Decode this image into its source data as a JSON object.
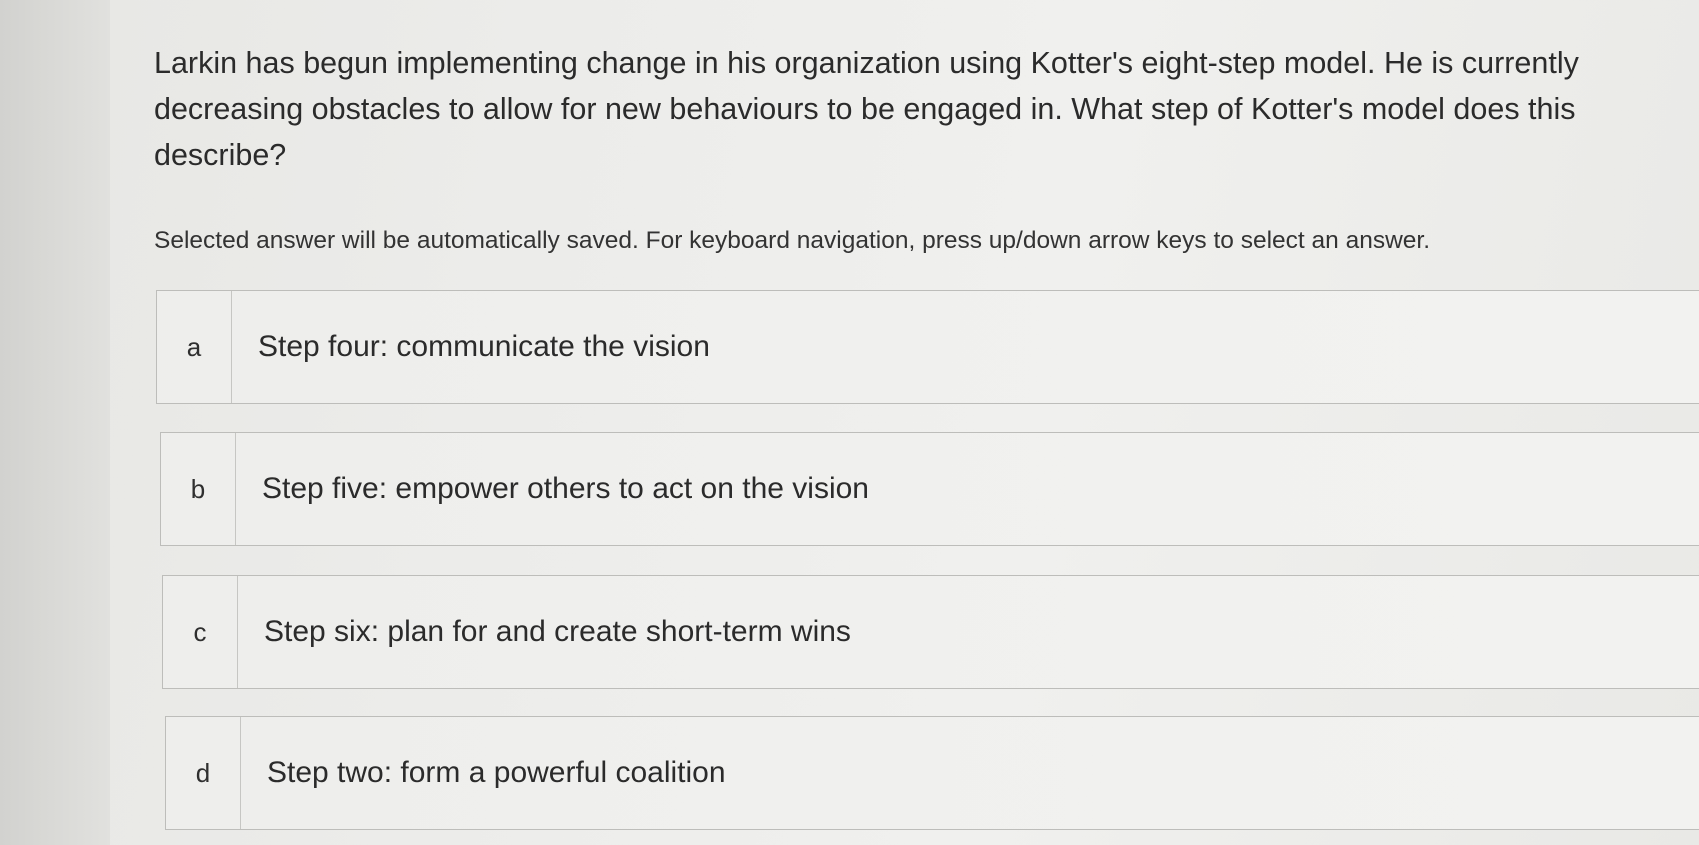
{
  "question": {
    "text": "Larkin has begun implementing change in his organization using Kotter's eight-step model. He is currently decreasing obstacles to allow for new behaviours to be engaged in. What step of Kotter's model does this describe?"
  },
  "instructions": "Selected answer will be automatically saved. For keyboard navigation, press up/down arrow keys to select an answer.",
  "options": [
    {
      "letter": "a",
      "text": "Step four: communicate the vision"
    },
    {
      "letter": "b",
      "text": "Step five: empower others to act on the vision"
    },
    {
      "letter": "c",
      "text": "Step six: plan for and create short-term wins"
    },
    {
      "letter": "d",
      "text": "Step two: form a powerful coalition"
    }
  ]
}
